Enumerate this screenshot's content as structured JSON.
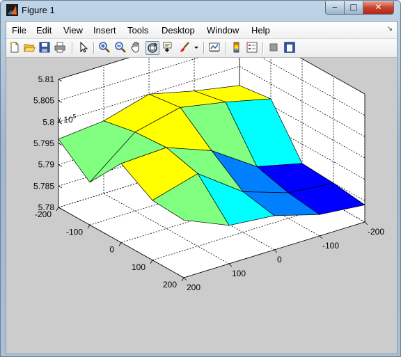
{
  "window": {
    "title": "Figure 1",
    "controls": {
      "minimize": "‒",
      "maximize": "□",
      "close": "✕"
    }
  },
  "menu": {
    "items": [
      "File",
      "Edit",
      "View",
      "Insert",
      "Tools",
      "Desktop",
      "Window",
      "Help"
    ],
    "dock_arrow": "↘"
  },
  "toolbar": {
    "buttons": [
      "new-figure",
      "open-file",
      "save-figure",
      "print-figure",
      "edit-plot-arrow",
      "zoom-in",
      "zoom-out",
      "pan",
      "rotate-3d",
      "data-cursor",
      "brush",
      "brush-dropdown",
      "link-plot",
      "insert-colorbar",
      "insert-legend",
      "hide-plot-tools",
      "show-plot-tools"
    ],
    "active": "rotate-3d"
  },
  "chart_data": {
    "type": "surface",
    "z_scale_label": "x 10",
    "z_scale_exponent": "5",
    "z_ticks": [
      "5.78",
      "5.785",
      "5.79",
      "5.795",
      "5.8",
      "5.805",
      "5.81"
    ],
    "zlim": [
      5.78,
      5.81
    ],
    "x_ticks": [
      "-200",
      "-100",
      "0",
      "100",
      "200"
    ],
    "y_ticks": [
      "-200",
      "-100",
      "0",
      "100",
      "200"
    ],
    "xlim": [
      -200,
      200
    ],
    "ylim": [
      -200,
      200
    ],
    "grid": true,
    "colormap": "jet",
    "colormap_colors": [
      "#00008f",
      "#0000ff",
      "#0080ff",
      "#00ffff",
      "#80ff80",
      "#ffff00",
      "#ff8000",
      "#ff0000",
      "#800000"
    ],
    "x": [
      -200,
      -100,
      0,
      100,
      200
    ],
    "y": [
      -200,
      -100,
      0,
      100,
      200
    ],
    "z": [
      [
        5.7955,
        5.7975,
        5.8,
        5.797,
        5.796
      ],
      [
        5.7965,
        5.799,
        5.801,
        5.7985,
        5.79
      ],
      [
        5.7855,
        5.788,
        5.795,
        5.799,
        5.7985
      ],
      [
        5.785,
        5.786,
        5.7895,
        5.797,
        5.794
      ],
      [
        5.784,
        5.785,
        5.788,
        5.789,
        5.7935
      ]
    ]
  }
}
